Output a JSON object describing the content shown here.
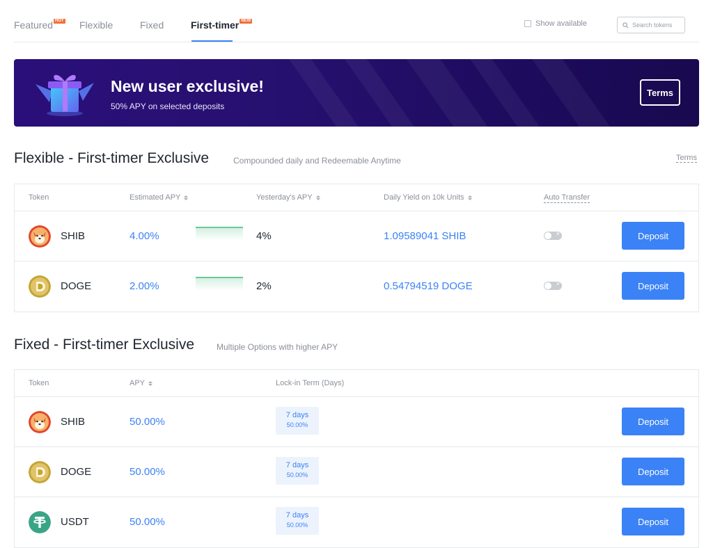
{
  "tabs": [
    {
      "label": "Featured",
      "badge": "HOT"
    },
    {
      "label": "Flexible"
    },
    {
      "label": "Fixed"
    },
    {
      "label": "First-timer",
      "badge": "NEW",
      "active": true
    }
  ],
  "show_available_label": "Show available",
  "search": {
    "placeholder": "Search tokens"
  },
  "banner": {
    "title": "New user exclusive!",
    "subtitle": "50% APY on selected deposits",
    "button_label": "Terms"
  },
  "flexible": {
    "title": "Flexible - First-timer Exclusive",
    "subtitle": "Compounded daily and Redeemable Anytime",
    "terms_label": "Terms",
    "columns": [
      "Token",
      "Estimated APY",
      "Yesterday's APY",
      "Daily Yield on 10k Units",
      "Auto Transfer"
    ],
    "rows": [
      {
        "token": "SHIB",
        "apy": "4.00%",
        "yesterday": "4%",
        "yield": "1.09589041 SHIB",
        "deposit": "Deposit"
      },
      {
        "token": "DOGE",
        "apy": "2.00%",
        "yesterday": "2%",
        "yield": "0.54794519 DOGE",
        "deposit": "Deposit"
      }
    ]
  },
  "fixed": {
    "title": "Fixed - First-timer Exclusive",
    "subtitle": "Multiple Options with higher APY",
    "columns": [
      "Token",
      "APY",
      "Lock-in Term (Days)"
    ],
    "rows": [
      {
        "token": "SHIB",
        "apy": "50.00%",
        "term_days": "7 days",
        "term_apy": "50.00%",
        "deposit": "Deposit"
      },
      {
        "token": "DOGE",
        "apy": "50.00%",
        "term_days": "7 days",
        "term_apy": "50.00%",
        "deposit": "Deposit"
      },
      {
        "token": "USDT",
        "apy": "50.00%",
        "term_days": "7 days",
        "term_apy": "50.00%",
        "deposit": "Deposit"
      }
    ]
  },
  "icons": {
    "shib": "shib-coin-icon",
    "doge": "doge-coin-icon",
    "usdt": "usdt-coin-icon",
    "search": "search-icon",
    "gift": "gift-box-icon"
  },
  "colors": {
    "accent": "#3b82f6",
    "banner": "#26106f",
    "sparkline": "#3dbb79",
    "usdt": "#3aa586"
  }
}
